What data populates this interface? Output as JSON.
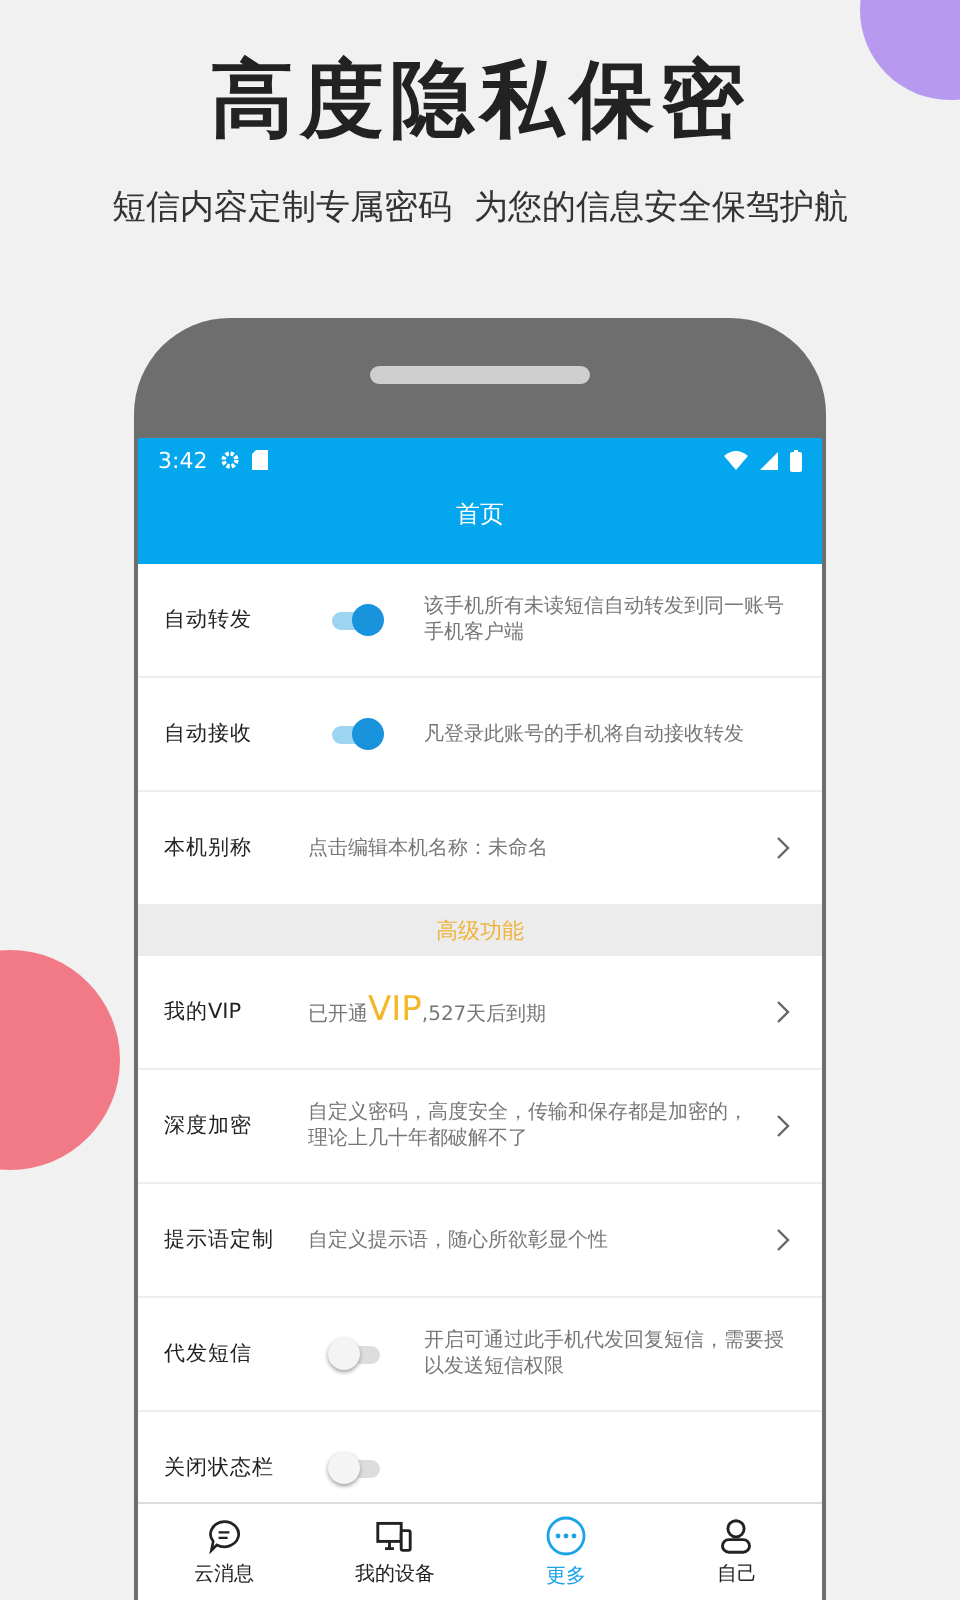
{
  "headline": "高度隐私保密",
  "subheadline": "短信内容定制专属密码  为您的信息安全保驾护航",
  "status_bar": {
    "time": "3:42"
  },
  "app_bar": {
    "title": "首页"
  },
  "rows": [
    {
      "kind": "toggle",
      "label": "自动转发",
      "on": true,
      "description": "该手机所有未读短信自动转发到同一账号手机客户端"
    },
    {
      "kind": "toggle",
      "label": "自动接收",
      "on": true,
      "description": "凡登录此账号的手机将自动接收转发"
    },
    {
      "kind": "link",
      "label": "本机别称",
      "description": "点击编辑本机名称：未命名"
    },
    {
      "kind": "section",
      "label": "高级功能"
    },
    {
      "kind": "vip",
      "label": "我的VIP",
      "prefix": "已开通",
      "highlight": "VIP",
      "suffix": ",527天后到期"
    },
    {
      "kind": "link",
      "label": "深度加密",
      "description": "自定义密码，高度安全，传输和保存都是加密的，理论上几十年都破解不了"
    },
    {
      "kind": "link",
      "label": "提示语定制",
      "description": "自定义提示语，随心所欲彰显个性"
    },
    {
      "kind": "toggle",
      "label": "代发短信",
      "on": false,
      "description": "开启可通过此手机代发回复短信，需要授以发送短信权限"
    },
    {
      "kind": "toggle",
      "label": "关闭状态栏",
      "on": false
    }
  ],
  "nav": [
    {
      "kind": "chat",
      "label": "云消息",
      "selected": false
    },
    {
      "kind": "devices",
      "label": "我的设备",
      "selected": false
    },
    {
      "kind": "more",
      "label": "更多",
      "selected": true
    },
    {
      "kind": "person",
      "label": "自己",
      "selected": false
    }
  ]
}
